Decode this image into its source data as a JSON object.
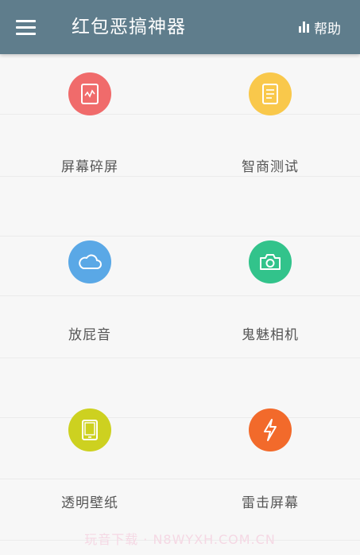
{
  "appbar": {
    "menu_icon": "menu-icon",
    "title": "红包恶搞神器",
    "help_label": "帮助",
    "help_icon": "bar-chart-icon",
    "color": "#5f7d8c"
  },
  "features": [
    {
      "label": "屏幕碎屏",
      "icon": "cracked-screen-icon",
      "color": "#f06b6b"
    },
    {
      "label": "智商测试",
      "icon": "document-icon",
      "color": "#f9c84b"
    },
    {
      "label": "放屁音",
      "icon": "cloud-icon",
      "color": "#5aa8e6"
    },
    {
      "label": "鬼魅相机",
      "icon": "camera-icon",
      "color": "#32c38b"
    },
    {
      "label": "透明壁纸",
      "icon": "tablet-icon",
      "color": "#cdd120"
    },
    {
      "label": "雷击屏幕",
      "icon": "lightning-icon",
      "color": "#f26a2b"
    }
  ],
  "watermark": "玩音下载 · N8WYXH.COM.CN"
}
